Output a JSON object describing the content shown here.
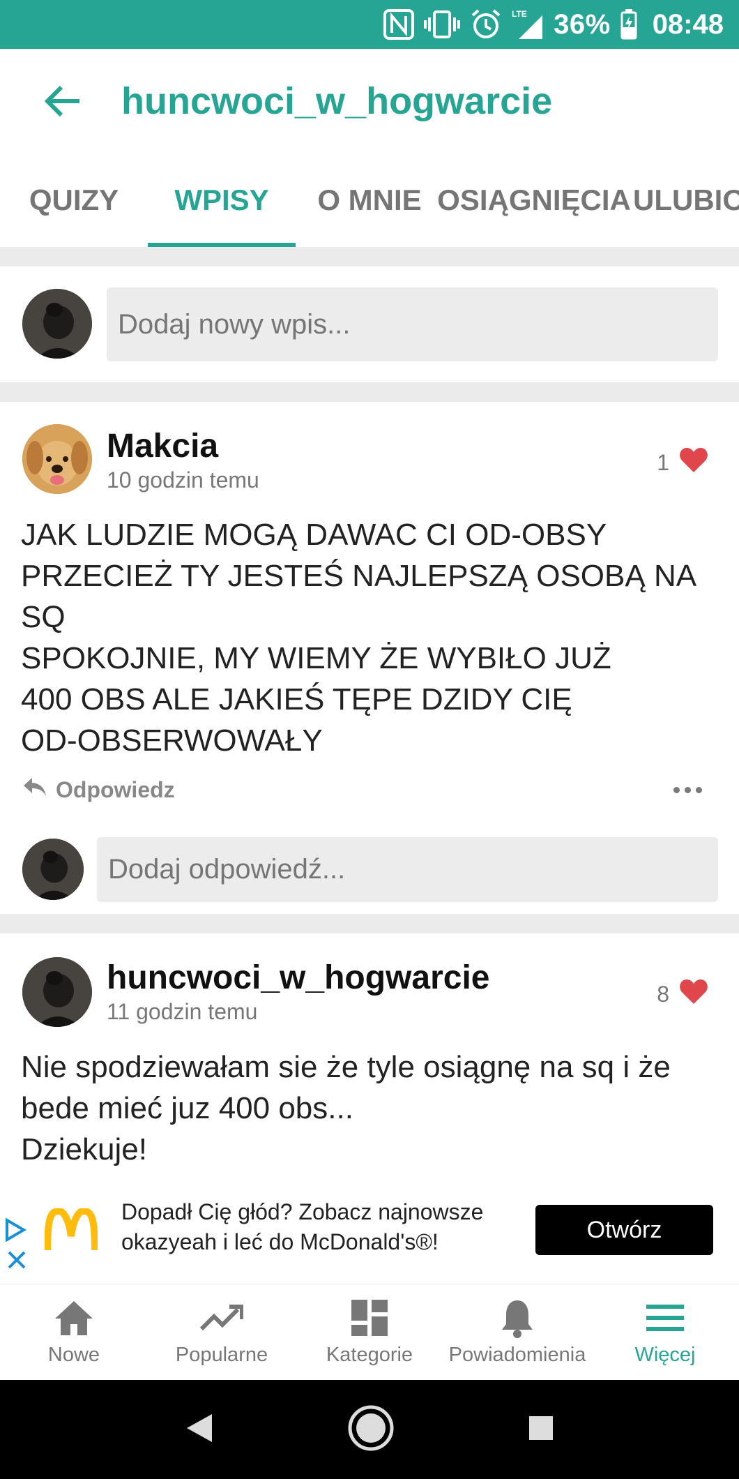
{
  "status_bar": {
    "battery": "36%",
    "time": "08:48",
    "network": "LTE"
  },
  "app_bar": {
    "title": "huncwoci_w_hogwarcie"
  },
  "tabs": [
    {
      "label": "QUIZY",
      "active": false
    },
    {
      "label": "WPISY",
      "active": true
    },
    {
      "label": "O MNIE",
      "active": false
    },
    {
      "label": "OSIĄGNIĘCIA",
      "active": false
    },
    {
      "label": "ULUBIONE",
      "active": false
    }
  ],
  "compose": {
    "placeholder": "Dodaj nowy wpis..."
  },
  "posts": [
    {
      "author": "Makcia",
      "time": "10 godzin temu",
      "likes": "1",
      "body": "JAK LUDZIE MOGĄ DAWAC CI OD-OBSY\nPRZECIEŻ TY JESTEŚ NAJLEPSZĄ OSOBĄ NA SQ\nSPOKOJNIE, MY WIEMY ŻE WYBIŁO JUŻ\n400 OBS ALE JAKIEŚ TĘPE DZIDY CIĘ\nOD-OBSERWOWAŁY",
      "reply_label": "Odpowiedz",
      "reply_placeholder": "Dodaj odpowiedź..."
    },
    {
      "author": "huncwoci_w_hogwarcie",
      "time": "11 godzin temu",
      "likes": "8",
      "body": "Nie spodziewałam sie że tyle osiągnę na sq i że bede mieć juz 400 obs...\nDziekuje!"
    }
  ],
  "ad": {
    "text_line1": "Dopadł Cię głód? Zobacz najnowsze",
    "text_line2": "okazyeah i leć do McDonald's®!",
    "button": "Otwórz"
  },
  "bottom_nav": [
    {
      "label": "Nowe",
      "icon": "home-icon",
      "active": false
    },
    {
      "label": "Popularne",
      "icon": "trending-icon",
      "active": false
    },
    {
      "label": "Kategorie",
      "icon": "dashboard-icon",
      "active": false
    },
    {
      "label": "Powiadomienia",
      "icon": "bell-icon",
      "active": false
    },
    {
      "label": "Więcej",
      "icon": "menu-icon",
      "active": true
    }
  ],
  "colors": {
    "accent": "#26a594",
    "like": "#e0474c"
  }
}
